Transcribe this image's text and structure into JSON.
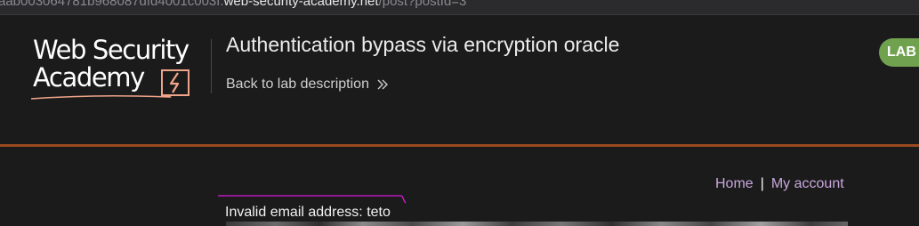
{
  "browser": {
    "url_prefix": "aab003064781b968087dfd4001c003f.",
    "url_host": "web-security-academy.net",
    "url_path": "/post?postId=3"
  },
  "header": {
    "logo_line1": "Web Security",
    "logo_line2": "Academy",
    "lab_title": "Authentication bypass via encryption oracle",
    "back_link": "Back to lab description",
    "badge": "LAB",
    "badge_color": "#70a14f",
    "accent_rule_color": "#9a4a1f"
  },
  "nav": {
    "home": "Home",
    "separator": "|",
    "my_account": "My account",
    "link_color": "#c9a7dd"
  },
  "main": {
    "error_message": "Invalid email address: teto"
  },
  "icons": {
    "back": "chevron-double-right-icon",
    "logo_mark": "lightning-icon"
  }
}
